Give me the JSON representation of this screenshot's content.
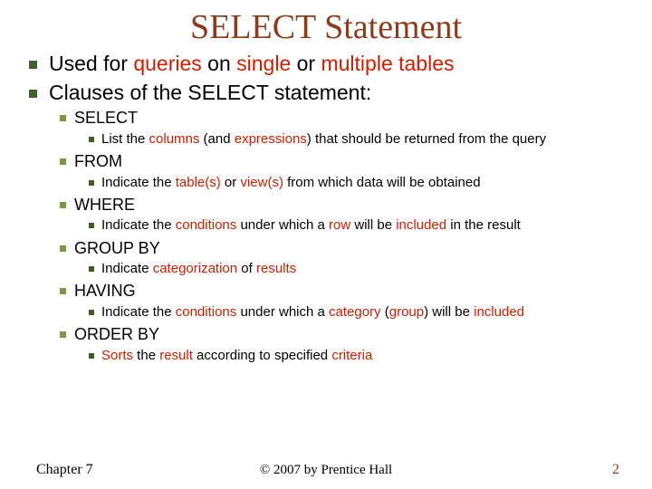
{
  "title": "SELECT Statement",
  "points": {
    "p1_a": "Used for ",
    "p1_b": "queries",
    "p1_c": " on ",
    "p1_d": "single",
    "p1_e": " or ",
    "p1_f": "multiple tables",
    "p2": "Clauses of the SELECT statement:"
  },
  "clauses": {
    "select": {
      "name": "SELECT",
      "d1": "List the ",
      "d2": "columns",
      "d3": " (and ",
      "d4": "expressions",
      "d5": ") that should be returned from the query"
    },
    "from": {
      "name": "FROM",
      "d1": "Indicate the ",
      "d2": "table(s)",
      "d3": " or ",
      "d4": "view(s)",
      "d5": " from which data will be obtained"
    },
    "where": {
      "name": "WHERE",
      "d1": "Indicate the ",
      "d2": "conditions",
      "d3": " under which a ",
      "d4": "row",
      "d5": " will be ",
      "d6": "included",
      "d7": " in the result"
    },
    "groupby": {
      "name": "GROUP BY",
      "d1": "Indicate ",
      "d2": "categorization",
      "d3": " of ",
      "d4": "results"
    },
    "having": {
      "name": "HAVING",
      "d1": "Indicate the ",
      "d2": "conditions",
      "d3": " under which a ",
      "d4": "category",
      "d5": " (",
      "d6": "group",
      "d7": ") will be ",
      "d8": "included"
    },
    "orderby": {
      "name": "ORDER BY",
      "d1": "Sorts",
      "d2": " the ",
      "d3": "result",
      "d4": " according to specified ",
      "d5": "criteria"
    }
  },
  "footer": {
    "left": "Chapter 7",
    "center": "© 2007 by Prentice Hall",
    "right": "2"
  }
}
